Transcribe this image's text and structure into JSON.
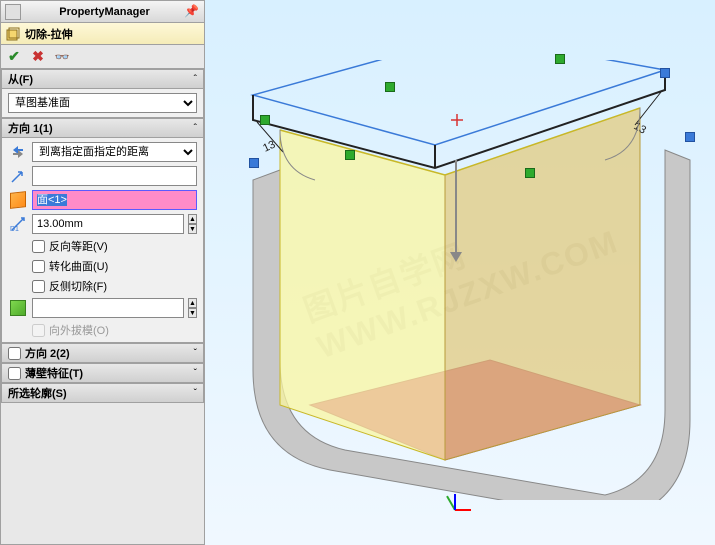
{
  "panel_title": "PropertyManager",
  "feature_name": "切除-拉伸",
  "sections": {
    "from": {
      "label": "从(F)",
      "value": "草图基准面"
    },
    "dir1": {
      "label": "方向 1(1)",
      "end_condition": "到离指定面指定的距离",
      "face_value": "面<1>",
      "depth": "13.00mm",
      "cb_reverse_offset": "反向等距(V)",
      "cb_translate_surface": "转化曲面(U)",
      "cb_flip_side": "反侧切除(F)",
      "cb_draft_outward": "向外拔模(O)"
    },
    "dir2": {
      "label": "方向 2(2)"
    },
    "thin": {
      "label": "薄壁特征(T)"
    },
    "contours": {
      "label": "所选轮廓(S)"
    }
  },
  "dims": {
    "d1": "13",
    "d2": "13"
  },
  "watermark": "图片自学网 WWW.RJZXW.COM"
}
